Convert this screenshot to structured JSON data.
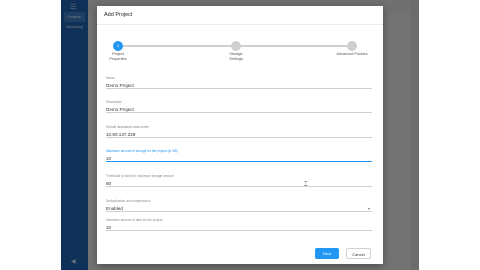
{
  "background_app": {
    "menu_icon": "hamburger-icon",
    "nav_items": [
      "Projects",
      "Monitoring"
    ]
  },
  "dialog": {
    "title": "Add Project",
    "steps": [
      {
        "number": "1",
        "label": "Project\nProperties",
        "state": "active"
      },
      {
        "number": "",
        "label": "Storage\nSettings",
        "state": "todo"
      },
      {
        "number": "",
        "label": "Advanced Policies",
        "state": "todo"
      }
    ],
    "fields": [
      {
        "label": "Name",
        "value": "Demo Project"
      },
      {
        "label": "Description",
        "value": "Demo Project"
      },
      {
        "label": "Default destination data center",
        "value": "10.80.137.228"
      },
      {
        "label": "Maximum amount of storage for the project (in GB)",
        "value": "10"
      },
      {
        "label": "Threshold to warn for maximum storage amount",
        "value": "80"
      },
      {
        "label": "Deduplication and compression",
        "value": "Enabled"
      },
      {
        "label": "Maximum amount of data for the project",
        "value": "10"
      }
    ],
    "next_label": "Next",
    "cancel_label": "Cancel"
  },
  "colors": {
    "accent": "#2196f3",
    "nav": "#1f5fa8",
    "overlay": "#000000"
  }
}
